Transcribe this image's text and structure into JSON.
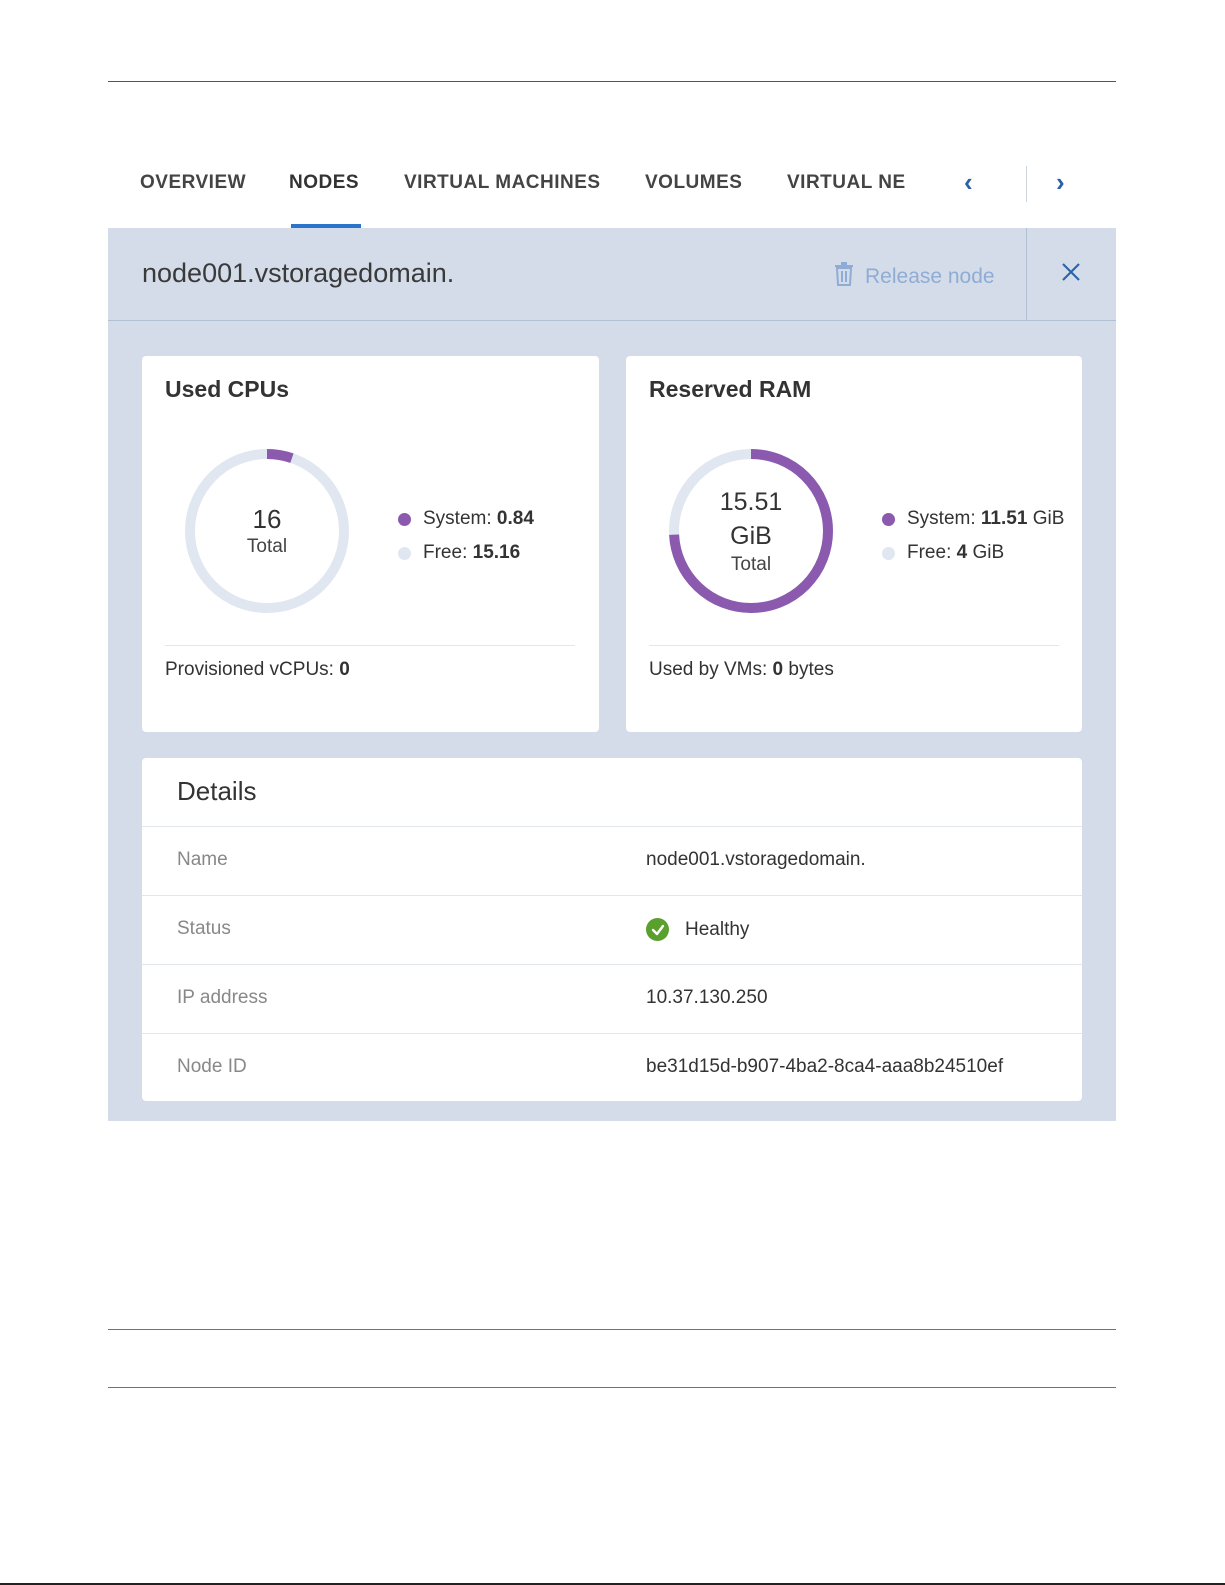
{
  "tabs": [
    {
      "label": "OVERVIEW",
      "active": false
    },
    {
      "label": "NODES",
      "active": true
    },
    {
      "label": "VIRTUAL MACHINES",
      "active": false
    },
    {
      "label": "VOLUMES",
      "active": false
    },
    {
      "label": "VIRTUAL NE",
      "active": false
    }
  ],
  "tab_nav": {
    "prev_icon": "chevron-left-icon",
    "next_icon": "chevron-right-icon",
    "prev_glyph": "‹",
    "next_glyph": "›"
  },
  "panel": {
    "title": "node001.vstoragedomain.",
    "release_label": "Release node",
    "release_icon": "trash-icon",
    "close_icon": "close-icon"
  },
  "cpu": {
    "title": "Used CPUs",
    "total_value": "16",
    "total_label": "Total",
    "system_label": "System:",
    "system_value": "0.84",
    "free_label": "Free:",
    "free_value": "15.16",
    "used_fraction": 0.0525,
    "footer_label": "Provisioned vCPUs:",
    "footer_value": "0"
  },
  "ram": {
    "title": "Reserved RAM",
    "total_value": "15.51",
    "total_unit": "GiB",
    "total_label": "Total",
    "system_label": "System:",
    "system_value": "11.51",
    "system_unit": "GiB",
    "free_label": "Free:",
    "free_value": "4",
    "free_unit": "GiB",
    "used_fraction": 0.742,
    "footer_label": "Used by VMs:",
    "footer_value": "0",
    "footer_unit": "bytes"
  },
  "details": {
    "title": "Details",
    "rows": [
      {
        "label": "Name",
        "value": "node001.vstoragedomain."
      },
      {
        "label": "Status",
        "value": "Healthy"
      },
      {
        "label": "IP address",
        "value": "10.37.130.250"
      },
      {
        "label": "Node ID",
        "value": "be31d15d-b907-4ba2-8ca4-aaa8b24510ef"
      }
    ]
  },
  "colors": {
    "accent": "#2a74c9",
    "used": "#8b5aaf",
    "free": "#e0e7f1",
    "panel_bg": "#d3dce8",
    "healthy": "#5aa02c"
  }
}
